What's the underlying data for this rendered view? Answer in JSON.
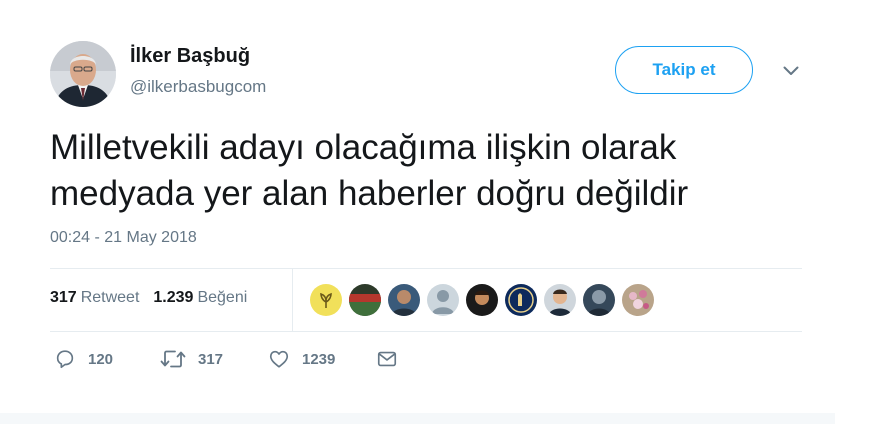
{
  "author": {
    "name": "İlker Başbuğ",
    "handle": "@ilkerbasbugcom"
  },
  "follow_label": "Takip et",
  "tweet": {
    "text_line1": "Milletvekili adayı olacağıma ilişkin olarak",
    "text_line2": "medyada yer alan haberler doğru değildir",
    "timestamp": "00:24 - 21 May 2018"
  },
  "stats": {
    "retweet_count": "317",
    "retweet_label": "Retweet",
    "like_count": "1.239",
    "like_label": "Beğeni"
  },
  "actions": {
    "reply_count": "120",
    "retweet_count": "317",
    "like_count": "1239"
  },
  "colors": {
    "accent": "#1da1f2",
    "text": "#14171a",
    "muted": "#657786"
  },
  "icons": [
    "chevron-down-icon",
    "reply-icon",
    "retweet-icon",
    "heart-icon",
    "message-icon"
  ]
}
